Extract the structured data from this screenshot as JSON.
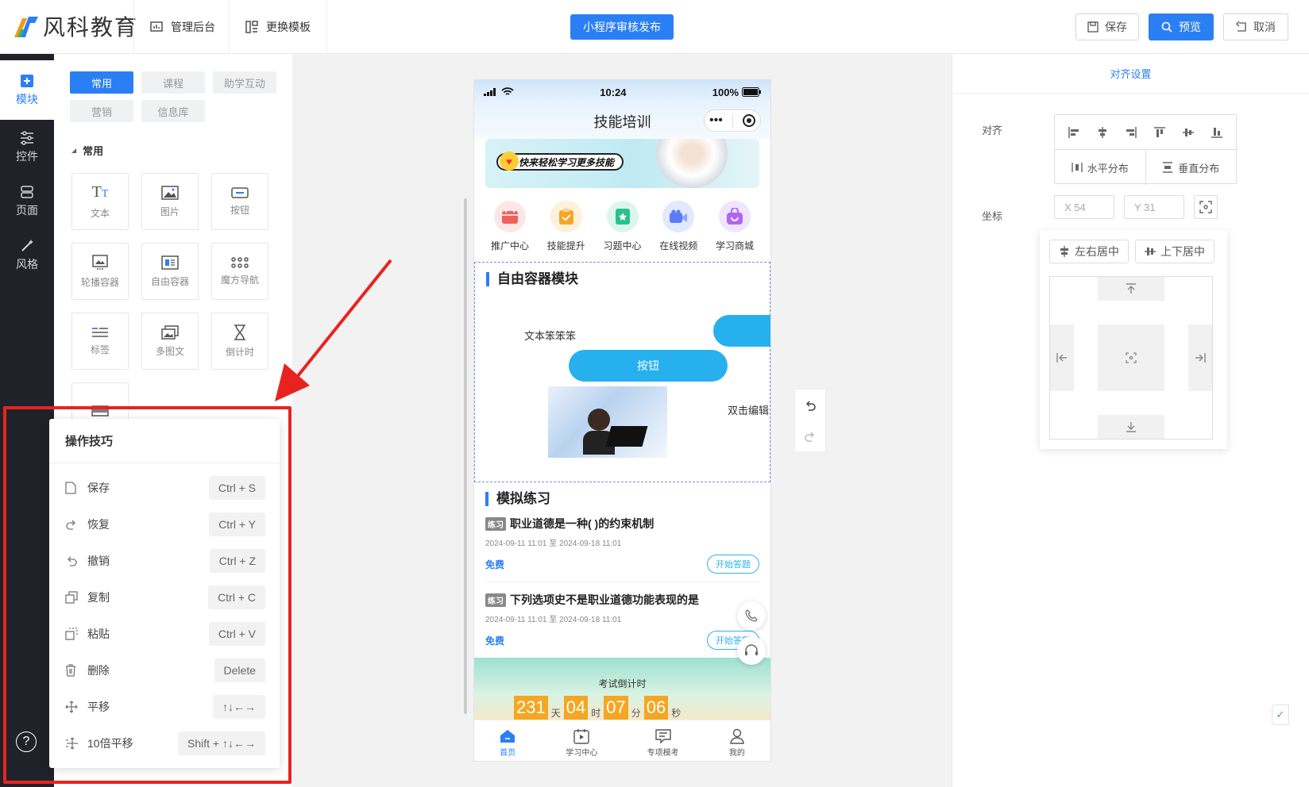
{
  "header": {
    "logo_text": "风科教育",
    "admin_link": "管理后台",
    "template_link": "更换模板",
    "publish_button": "小程序审核发布",
    "save_button": "保存",
    "preview_button": "预览",
    "cancel_button": "取消"
  },
  "sidebar": {
    "items": [
      {
        "label": "模块",
        "icon": "plus-square-icon",
        "active": true
      },
      {
        "label": "控件",
        "icon": "sliders-icon",
        "active": false
      },
      {
        "label": "页面",
        "icon": "pages-icon",
        "active": false
      },
      {
        "label": "风格",
        "icon": "magic-wand-icon",
        "active": false
      }
    ]
  },
  "panel": {
    "chips": [
      "常用",
      "课程",
      "助学互动",
      "营销",
      "信息库"
    ],
    "section_title": "常用",
    "components": [
      "文本",
      "图片",
      "按钮",
      "轮播容器",
      "自由容器",
      "魔方导航",
      "标签",
      "多图文",
      "倒计时"
    ]
  },
  "tips": {
    "title": "操作技巧",
    "rows": [
      {
        "label": "保存",
        "key": "Ctrl + S",
        "icon": "file-icon"
      },
      {
        "label": "恢复",
        "key": "Ctrl + Y",
        "icon": "redo-icon"
      },
      {
        "label": "撤销",
        "key": "Ctrl + Z",
        "icon": "undo-icon"
      },
      {
        "label": "复制",
        "key": "Ctrl + C",
        "icon": "copy-icon"
      },
      {
        "label": "粘贴",
        "key": "Ctrl + V",
        "icon": "paste-icon"
      },
      {
        "label": "删除",
        "key": "Delete",
        "icon": "trash-icon"
      },
      {
        "label": "平移",
        "key": "↑↓←→",
        "icon": "move-icon"
      },
      {
        "label": "10倍平移",
        "key": "Shift + ↑↓←→",
        "icon": "move-fast-icon"
      }
    ]
  },
  "phone": {
    "time": "10:24",
    "battery": "100%",
    "nav_title": "技能培训",
    "banner_text": "快来轻松学习更多技能",
    "categories": [
      {
        "label": "推广中心",
        "color": "#f0605a",
        "bg": "#fde7e6"
      },
      {
        "label": "技能提升",
        "color": "#f5a623",
        "bg": "#fdf0dc"
      },
      {
        "label": "习题中心",
        "color": "#27c28a",
        "bg": "#dcf6ec"
      },
      {
        "label": "在线视频",
        "color": "#5b7cf5",
        "bg": "#e2e8fd"
      },
      {
        "label": "学习商城",
        "color": "#b064f0",
        "bg": "#f1e4fd"
      }
    ],
    "free_container_title": "自由容器模块",
    "free_text": "文本笨笨笨",
    "free_button": "按钮",
    "dblclick_text": "双击编辑",
    "practice_title": "模拟练习",
    "practice_items": [
      {
        "tag": "练习",
        "title": "职业道德是一种( )的约束机制",
        "date": "2024-09-11 11:01 至 2024-09-18 11:01",
        "price": "免费",
        "button": "开始答题"
      },
      {
        "tag": "练习",
        "title": "下列选项史不是职业道德功能表现的是",
        "date": "2024-09-11 11:01 至 2024-09-18 11:01",
        "price": "免费",
        "button": "开始答题"
      }
    ],
    "countdown": {
      "title": "考试倒计时",
      "days": "231",
      "days_unit": "天",
      "hours": "04",
      "hours_unit": "时",
      "minutes": "07",
      "minutes_unit": "分",
      "seconds": "06",
      "seconds_unit": "秒"
    },
    "tabs": [
      {
        "label": "首页",
        "active": true
      },
      {
        "label": "学习中心",
        "active": false
      },
      {
        "label": "专项模考",
        "active": false
      },
      {
        "label": "我的",
        "active": false
      }
    ]
  },
  "right_panel": {
    "tab_title": "对齐设置",
    "align_label": "对齐",
    "h_distribute": "水平分布",
    "v_distribute": "垂直分布",
    "coord_label": "坐标",
    "x_placeholder": "X  54",
    "y_placeholder": "Y  31",
    "center_h": "左右居中",
    "center_v": "上下居中"
  }
}
